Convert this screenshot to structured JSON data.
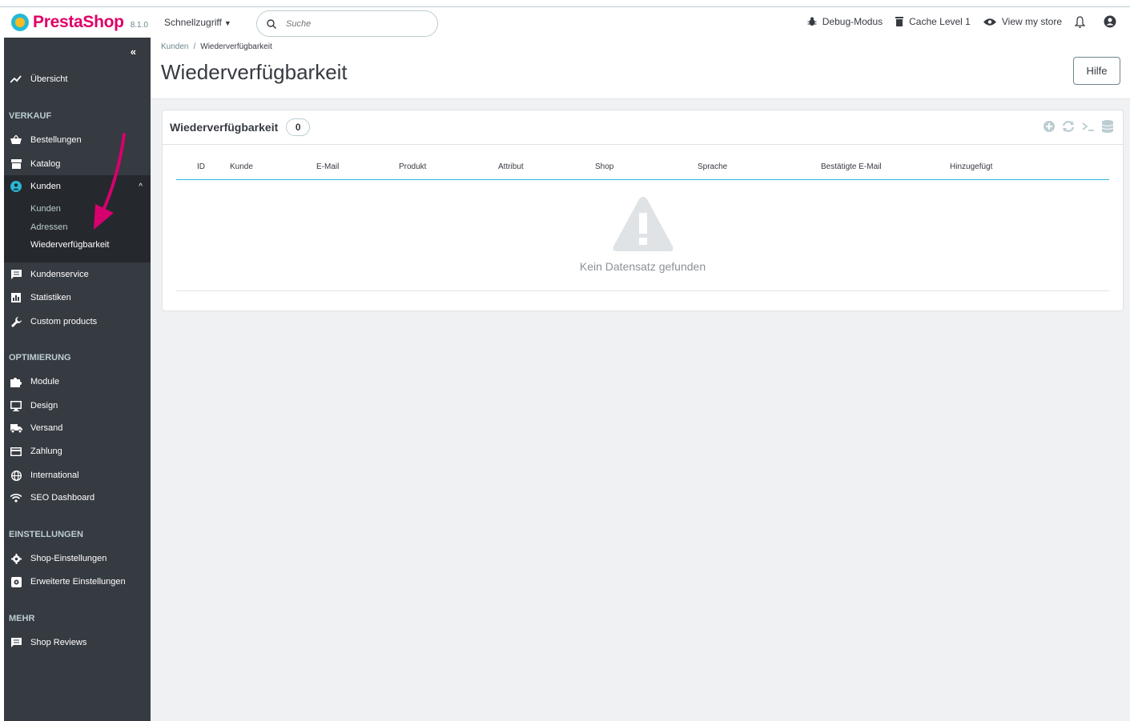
{
  "header": {
    "brand": "PrestaShop",
    "version": "8.1.0",
    "quick_access": "Schnellzugriff",
    "search_placeholder": "Suche",
    "debug_mode": "Debug-Modus",
    "cache_level": "Cache Level 1",
    "view_store": "View my store"
  },
  "sidebar": {
    "overview": "Übersicht",
    "sections": {
      "sales": "VERKAUF",
      "optimize": "OPTIMIERUNG",
      "settings": "EINSTELLUNGEN",
      "more": "MEHR"
    },
    "items": {
      "orders": "Bestellungen",
      "catalog": "Katalog",
      "customers": "Kunden",
      "customers_sub": "Kunden",
      "addresses": "Adressen",
      "availability": "Wiederverfügbarkeit",
      "customer_service": "Kundenservice",
      "statistics": "Statistiken",
      "custom_products": "Custom products",
      "modules": "Module",
      "design": "Design",
      "shipping": "Versand",
      "payment": "Zahlung",
      "international": "International",
      "seo_dashboard": "SEO Dashboard",
      "shop_settings": "Shop-Einstellungen",
      "advanced_settings": "Erweiterte Einstellungen",
      "shop_reviews": "Shop Reviews"
    }
  },
  "toolbar": {
    "breadcrumb_parent": "Kunden",
    "breadcrumb_current": "Wiederverfügbarkeit",
    "title": "Wiederverfügbarkeit",
    "help": "Hilfe"
  },
  "panel": {
    "title": "Wiederverfügbarkeit",
    "count": "0",
    "columns": [
      "ID",
      "Kunde",
      "E-Mail",
      "Produkt",
      "Attribut",
      "Shop",
      "Sprache",
      "Bestätigte E-Mail",
      "Hinzugefügt"
    ],
    "empty_message": "Kein Datensatz gefunden"
  },
  "colors": {
    "sidebar_bg": "#363a41",
    "sidebar_active_bg": "#25282d",
    "brand_pink": "#df0067",
    "accent_blue": "#25b9d7",
    "content_bg": "#eff1f2",
    "arrow": "#d6006e"
  }
}
